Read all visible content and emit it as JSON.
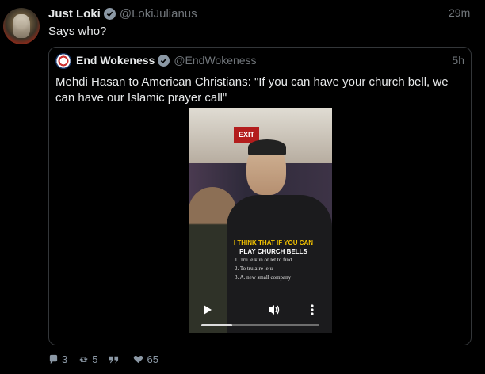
{
  "tweet": {
    "author_name": "Just Loki",
    "author_handle": "@LokiJulianus",
    "time": "29m",
    "text": "Says who?"
  },
  "quoted": {
    "author_name": "End Wokeness",
    "author_handle": "@EndWokeness",
    "time": "5h",
    "text": "Mehdi Hasan to American Christians: \"If you can have your church bell, we can have our Islamic prayer call\"",
    "video": {
      "exit_sign": "EXIT",
      "caption_line1": "I THINK THAT IF YOU CAN",
      "caption_line2": "PLAY CHURCH BELLS",
      "shirt_text": [
        "1. Tru .e k in or let to find",
        "2. To tru aire le u",
        "3. A. new small company"
      ],
      "progress": 0.26
    }
  },
  "actions": {
    "replies": "3",
    "retweets": "5",
    "likes": "65"
  },
  "colors": {
    "background": "#000000",
    "muted": "#71767b",
    "border": "#333639"
  }
}
